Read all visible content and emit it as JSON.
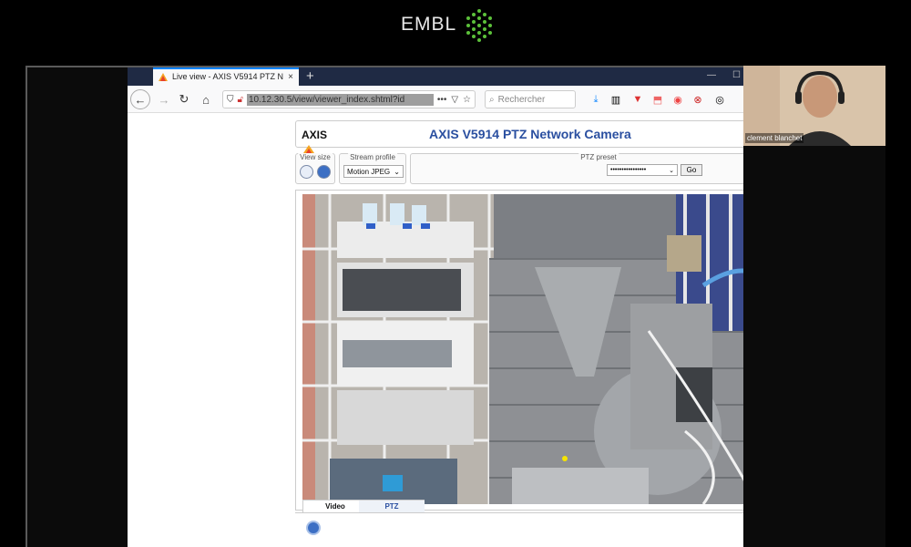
{
  "header": {
    "org_name": "EMBL"
  },
  "browser": {
    "tab_title": "Live view - AXIS V5914 PTZ Ne",
    "tab_close": "×",
    "new_tab": "+",
    "url": "10.12.30.5/view/viewer_index.shtml?id",
    "search_placeholder": "Rechercher",
    "url_more": "•••"
  },
  "axis": {
    "brand": "AXIS",
    "title": "AXIS V5914 PTZ Network Camera",
    "view_size_label": "View size",
    "stream_profile_label": "Stream profile",
    "stream_profile_value": "Motion JPEG",
    "ptz_preset_label": "PTZ preset",
    "ptz_preset_value": "••••••••••••••••",
    "go_label": "Go",
    "tabs": [
      {
        "label": "Video"
      },
      {
        "label": "PTZ"
      }
    ]
  },
  "webcam": {
    "participant_name": "clement blanchet"
  },
  "colors": {
    "title_blue": "#2a4fa0",
    "firefox_tabbar": "#1f2a44",
    "accent": "#0a84ff"
  }
}
